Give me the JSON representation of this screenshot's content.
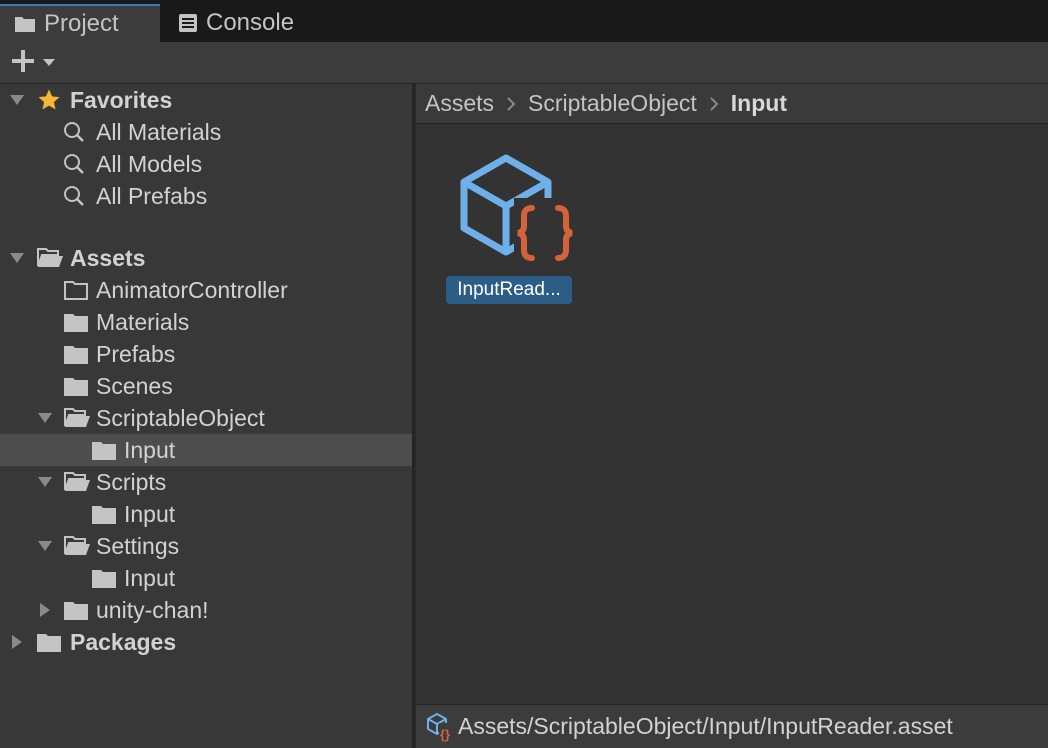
{
  "tabs": [
    {
      "label": "Project",
      "icon": "folder-icon",
      "active": true
    },
    {
      "label": "Console",
      "icon": "console-icon",
      "active": false
    }
  ],
  "toolbar": {
    "create_icon": "plus-icon",
    "dropdown_icon": "caret-down-icon"
  },
  "favorites": {
    "label": "Favorites",
    "items": [
      {
        "label": "All Materials"
      },
      {
        "label": "All Models"
      },
      {
        "label": "All Prefabs"
      }
    ]
  },
  "assets": {
    "label": "Assets",
    "items": [
      {
        "label": "AnimatorController"
      },
      {
        "label": "Materials"
      },
      {
        "label": "Prefabs"
      },
      {
        "label": "Scenes"
      },
      {
        "label": "ScriptableObject"
      },
      {
        "label": "Input"
      },
      {
        "label": "Scripts"
      },
      {
        "label": "Input"
      },
      {
        "label": "Settings"
      },
      {
        "label": "Input"
      },
      {
        "label": "unity-chan!"
      }
    ]
  },
  "packages": {
    "label": "Packages"
  },
  "breadcrumbs": [
    "Assets",
    "ScriptableObject",
    "Input"
  ],
  "asset_grid": [
    {
      "label": "InputRead...",
      "icon": "scriptable-object-icon"
    }
  ],
  "status": {
    "path": "Assets/ScriptableObject/Input/InputReader.asset",
    "icon": "scriptable-object-icon"
  },
  "colors": {
    "accent": "#3a79bb",
    "selection": "#2c5d87",
    "star": "#f5b731",
    "cube": "#6fb0ea",
    "braces": "#d4633b"
  }
}
